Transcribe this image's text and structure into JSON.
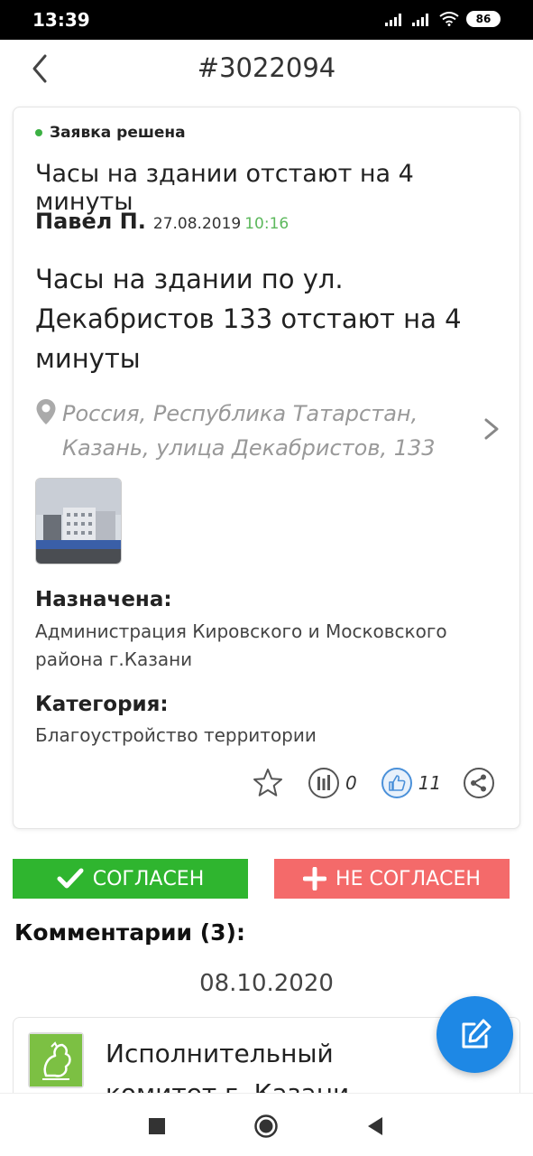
{
  "status_bar": {
    "time": "13:39",
    "battery": "86"
  },
  "header": {
    "title": "#3022094"
  },
  "card": {
    "status": "Заявка решена",
    "title": "Часы на здании отстают на 4 минуты",
    "author": "Павел П.",
    "date": "27.08.2019",
    "time": "10:16",
    "description": "Часы на здании по ул. Декабристов 133 отстают на 4 минуты",
    "address": "Россия, Республика Татарстан, Казань, улица Декабристов, 133",
    "assigned_label": "Назначена:",
    "assigned_value": "Администрация Кировского и Московского района г.Казани",
    "category_label": "Категория:",
    "category_value": "Благоустройство территории",
    "actions": {
      "votes_count": "0",
      "likes_count": "11"
    }
  },
  "buttons": {
    "agree": "СОГЛАСЕН",
    "disagree": "НЕ СОГЛАСЕН"
  },
  "comments": {
    "title": "Комментарии (3):",
    "date": "08.10.2020",
    "first_author": "Исполнительный комитет г. Казани"
  },
  "colors": {
    "agree": "#2fb52f",
    "disagree": "#f46a6a",
    "fab": "#1e88e5",
    "status_dot": "#3cb043",
    "time": "#5cb85c"
  },
  "icons": [
    "back-arrow-icon",
    "map-pin-icon",
    "chevron-right-icon",
    "star-icon",
    "chart-icon",
    "thumbs-up-icon",
    "share-icon",
    "check-icon",
    "plus-icon",
    "edit-icon"
  ]
}
